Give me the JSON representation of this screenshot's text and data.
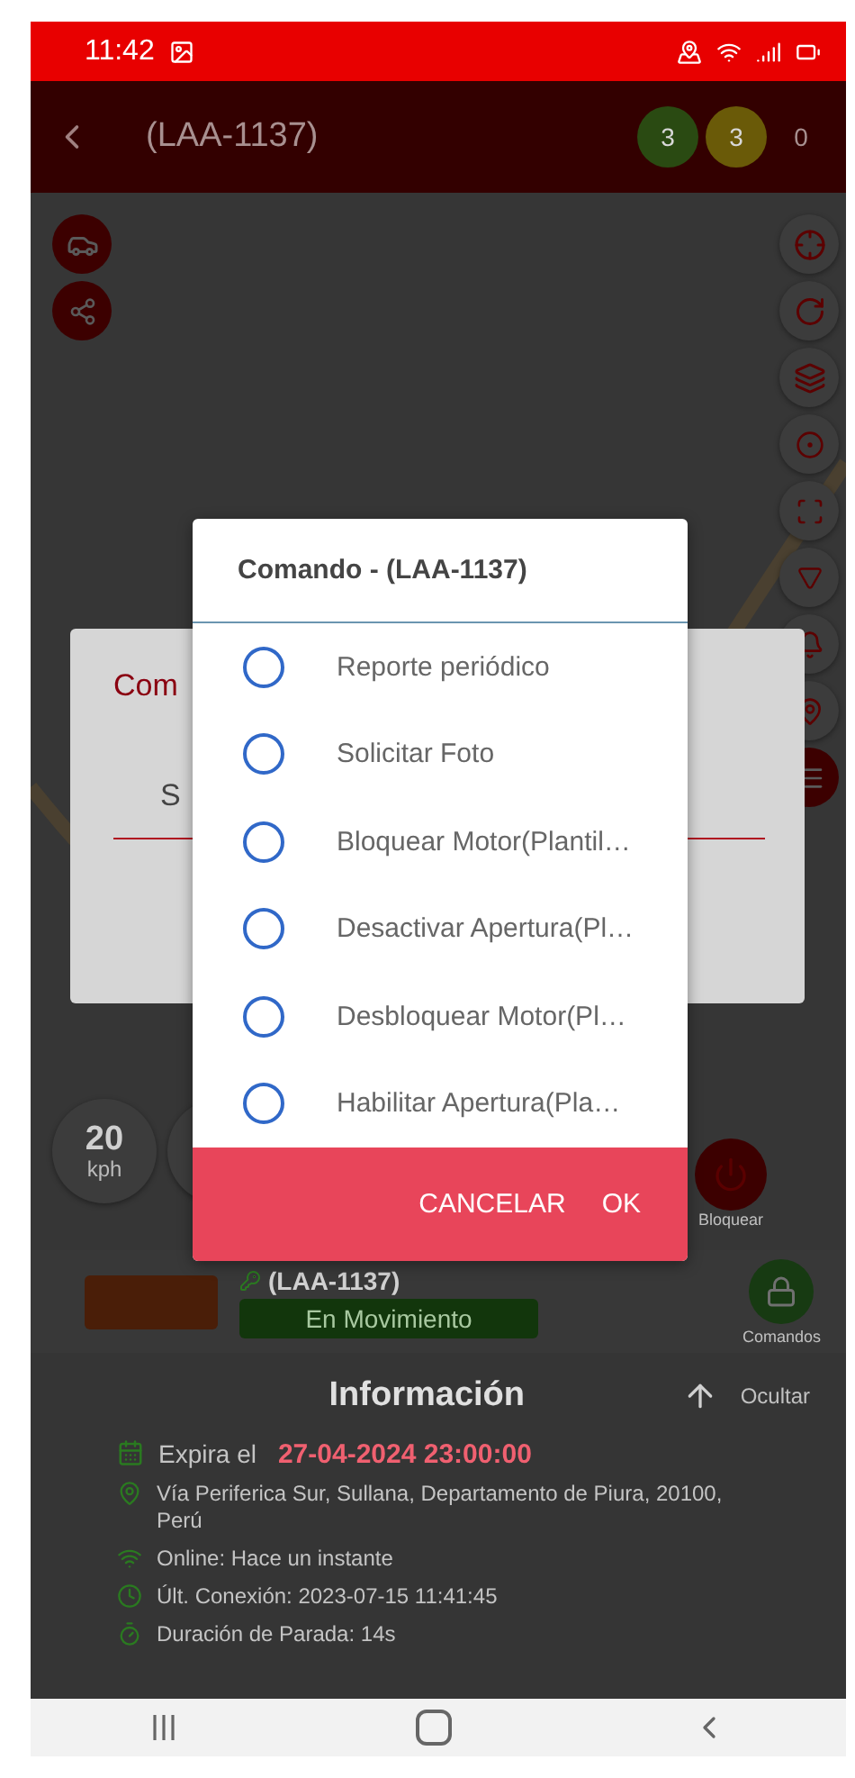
{
  "status_bar": {
    "time": "11:42"
  },
  "header": {
    "title": "(LAA-1137)",
    "counters": [
      {
        "value": "3",
        "color": "#2a4a12"
      },
      {
        "value": "3",
        "color": "#6a5a08"
      },
      {
        "value": "0"
      }
    ]
  },
  "map": {
    "speed": {
      "value": "20",
      "unit": "kph"
    },
    "block_label": "Bloquear"
  },
  "background_dialog": {
    "title": "Com",
    "select_value": "S"
  },
  "command_dialog": {
    "title": "Comando - (LAA-1137)",
    "options": [
      {
        "label": "Reporte periódico",
        "selected": false
      },
      {
        "label": "Solicitar Foto",
        "selected": false
      },
      {
        "label": "Bloquear Motor(Plantil…",
        "selected": false
      },
      {
        "label": "Desactivar Apertura(Pl…",
        "selected": false
      },
      {
        "label": "Desbloquear Motor(Pl…",
        "selected": false
      },
      {
        "label": "Habilitar Apertura(Pla…",
        "selected": false
      }
    ],
    "buttons": [
      "CANCELAR",
      "OK"
    ]
  },
  "vehicle": {
    "plate": "(LAA-1137)",
    "status": "En Movimiento",
    "commands_label": "Comandos"
  },
  "information": {
    "title": "Información",
    "toggle_label": "Ocultar",
    "expiry": {
      "label": "Expira el",
      "value": "27-04-2024 23:00:00"
    },
    "rows": [
      {
        "kind": "location",
        "text": "Vía Periferica Sur, Sullana, Departamento de Piura, 20100, Perú"
      },
      {
        "kind": "online",
        "text": "Online: Hace un instante"
      },
      {
        "kind": "connection",
        "text": "Últ. Conexión: 2023-07-15 11:41:45"
      },
      {
        "kind": "stop",
        "text": "Duración de Parada: 14s"
      }
    ]
  }
}
